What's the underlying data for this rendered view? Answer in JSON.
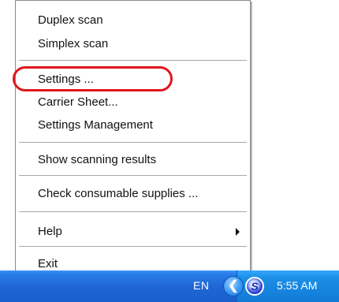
{
  "menu": {
    "items": [
      {
        "label": "Duplex scan"
      },
      {
        "label": "Simplex scan"
      },
      {
        "label": "Settings ..."
      },
      {
        "label": "Carrier Sheet..."
      },
      {
        "label": "Settings Management"
      },
      {
        "label": "Show scanning results"
      },
      {
        "label": "Check consumable supplies ..."
      },
      {
        "label": "Help"
      },
      {
        "label": "Exit"
      }
    ]
  },
  "taskbar": {
    "language": "EN",
    "chevron": "❮",
    "scan_icon_letter": "S",
    "clock": "5:55 AM"
  },
  "colors": {
    "highlight": "#e0161e",
    "taskbar": "#1f67d6",
    "tray": "#127ad6"
  }
}
